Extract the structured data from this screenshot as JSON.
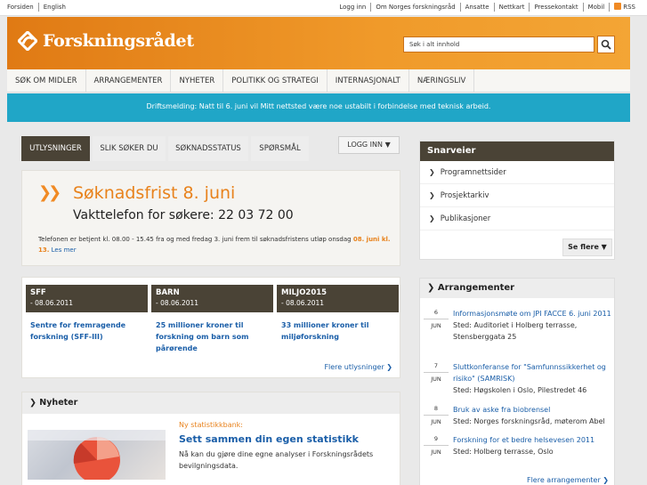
{
  "topbar": {
    "left": [
      "Forsiden",
      "English"
    ],
    "right": [
      "Logg inn",
      "Om Norges forskningsråd",
      "Ansatte",
      "Nettkart",
      "Pressekontakt",
      "Mobil",
      "RSS"
    ]
  },
  "banner": {
    "logo_text": "Forskningsrådet",
    "search_placeholder": "Søk i alt innhold",
    "accent": "#f08a24"
  },
  "nav": [
    "SØK OM MIDLER",
    "ARRANGEMENTER",
    "NYHETER",
    "POLITIKK OG STRATEGI",
    "INTERNASJONALT",
    "NÆRINGSLIV"
  ],
  "alert": "Driftsmelding: Natt til 6. juni vil Mitt nettsted være noe ustabilt i forbindelse med teknisk arbeid.",
  "tabs": [
    "UTLYSNINGER",
    "SLIK SØKER DU",
    "SØKNADSSTATUS",
    "SPØRSMÅL"
  ],
  "login_label": "LOGG INN",
  "deadline": {
    "title": "Søknadsfrist 8. juni",
    "phone": "Vakttelefon for søkere: 22 03 72 00",
    "info_a": "Telefonen er betjent kl. 08.00 - 15.45 fra og med fredag 3. juni frem til søknadsfristens utløp onsdag ",
    "info_hl": "08. juni kl. 13.",
    "info_link": "Les mer"
  },
  "cards": [
    {
      "cat": "SFF",
      "date": "- 08.06.2011",
      "text": "Sentre for fremragende forskning (SFF-III)"
    },
    {
      "cat": "BARN",
      "date": "- 08.06.2011",
      "text": "25 millioner kroner til forskning om barn som pårørende"
    },
    {
      "cat": "MILJO2015",
      "date": "- 08.06.2011",
      "text": "33 millioner kroner til miljøforskning"
    }
  ],
  "more_calls": "Flere utlysninger",
  "news": {
    "header": "Nyheter",
    "kicker": "Ny statistikkbank:",
    "headline": "Sett sammen din egen statistikk",
    "lede": "Nå kan du gjøre dine egne analyser i Forskningsrådets bevilgningsdata."
  },
  "shortcuts": {
    "header": "Snarveier",
    "items": [
      "Programnettsider",
      "Prosjektarkiv",
      "Publikasjoner"
    ],
    "more": "Se flere"
  },
  "events": {
    "header": "Arrangementer",
    "items": [
      {
        "day": "6",
        "month": "JUN",
        "title": "Informasjonsmøte om JPI FACCE 6. juni 2011",
        "place": "Sted: Auditoriet i Holberg terrasse, Stensberggata 25"
      },
      {
        "day": "7",
        "month": "JUN",
        "title": "Sluttkonferanse for \"Samfunnssikkerhet og risiko\" (SAMRISK)",
        "place": "Sted: Høgskolen i Oslo, Pilestredet 46"
      },
      {
        "day": "8",
        "month": "JUN",
        "title": "Bruk av aske fra biobrensel",
        "place": "Sted: Norges forskningsråd, møterom Abel"
      },
      {
        "day": "9",
        "month": "JUN",
        "title": "Forskning for et bedre helsevesen 2011",
        "place": "Sted: Holberg terrasse, Oslo"
      }
    ],
    "more": "Flere arrangementer"
  }
}
